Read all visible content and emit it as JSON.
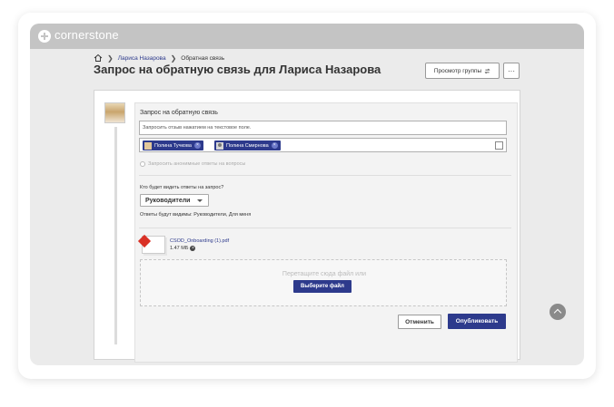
{
  "app": {
    "brand": "cornerstone"
  },
  "breadcrumb": {
    "link": "Лариса Назарова",
    "current": "Обратная связь"
  },
  "page": {
    "title": "Запрос на обратную связь для Лариса Назарова"
  },
  "header_actions": {
    "view_group": "Просмотр группы",
    "view_group_icon": "refresh-icon",
    "more": "···"
  },
  "request": {
    "label": "Запрос на обратную связь",
    "input_value": "Запросить отзыв нажатием на текстовое поле.",
    "recipients": [
      {
        "name": "Полина Тучкова",
        "avatar": "photo"
      },
      {
        "name": "Полина Смирнова",
        "avatar": "placeholder"
      }
    ],
    "anonymous_label": "Запросить анонимные ответы на вопросы",
    "visibility_question": "Кто будет видеть ответы на запрос?",
    "visibility_selected": "Руководители",
    "visibility_note": "Ответы будут видимы: Руководители, Для меня",
    "attachment": {
      "name": "CSOD_Onboarding (1).pdf",
      "size": "1.47 МБ"
    },
    "dropzone_text": "Перетащите сюда файл или",
    "choose_file": "Выберите файл",
    "cancel": "Отменить",
    "publish": "Опубликовать"
  },
  "colors": {
    "accent": "#2d3a8c",
    "titlebar": "#c4c4c4",
    "background": "#ebebeb"
  }
}
